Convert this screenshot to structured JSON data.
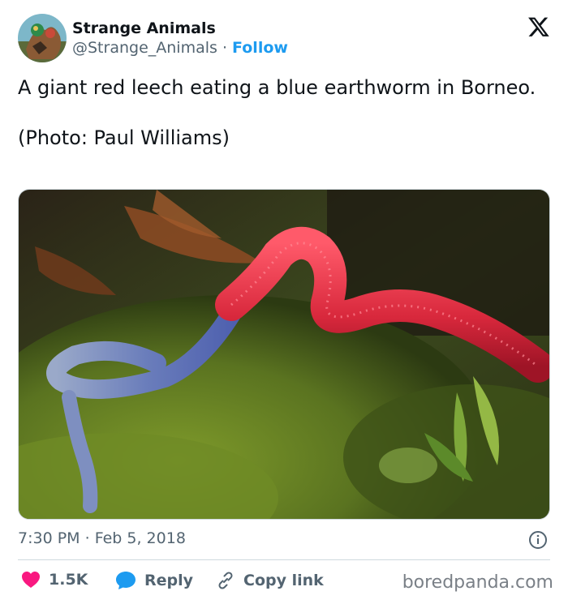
{
  "account": {
    "name": "Strange Animals",
    "handle": "@Strange_Animals",
    "separator": "·",
    "follow_label": "Follow"
  },
  "tweet": {
    "line1": "A giant red leech eating a blue earthworm in Borneo.",
    "line2": "(Photo: Paul Williams)",
    "time": "7:30 PM",
    "date": "Feb 5, 2018",
    "meta_separator": "·"
  },
  "actions": {
    "likes": "1.5K",
    "reply_label": "Reply",
    "copy_label": "Copy link"
  },
  "watermark": "boredpanda.com",
  "colors": {
    "accent": "#1d9bf0",
    "like": "#f91880",
    "text": "#0f1419",
    "secondary": "#536471"
  },
  "icons": {
    "platform": "x-logo-icon",
    "like": "heart-icon",
    "reply": "speech-bubble-icon",
    "copy": "link-icon",
    "info": "info-icon"
  }
}
